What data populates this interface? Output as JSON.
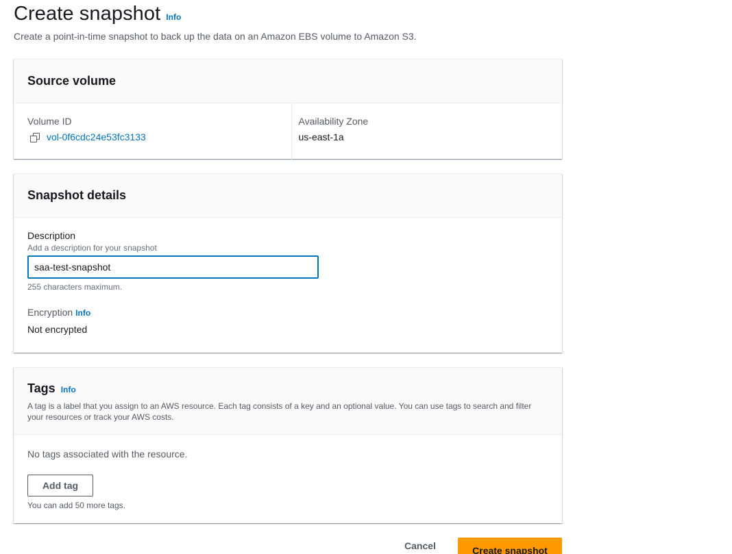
{
  "header": {
    "title": "Create snapshot",
    "info": "Info",
    "description": "Create a point-in-time snapshot to back up the data on an Amazon EBS volume to Amazon S3."
  },
  "source_volume": {
    "title": "Source volume",
    "volume_id_label": "Volume ID",
    "volume_id": "vol-0f6cdc24e53fc3133",
    "az_label": "Availability Zone",
    "az": "us-east-1a"
  },
  "snapshot_details": {
    "title": "Snapshot details",
    "description_label": "Description",
    "description_hint": "Add a description for your snapshot",
    "description_value": "saa-test-snapshot",
    "description_constraint": "255 characters maximum.",
    "encryption_label": "Encryption",
    "encryption_info": "Info",
    "encryption_value": "Not encrypted"
  },
  "tags": {
    "title": "Tags",
    "info": "Info",
    "description": "A tag is a label that you assign to an AWS resource. Each tag consists of a key and an optional value. You can use tags to search and filter your resources or track your AWS costs.",
    "empty": "No tags associated with the resource.",
    "add_label": "Add tag",
    "limit": "You can add 50 more tags."
  },
  "actions": {
    "cancel": "Cancel",
    "submit": "Create snapshot"
  },
  "colors": {
    "link": "#0073bb",
    "primary": "#ff9900",
    "text": "#16191f",
    "muted": "#545b64"
  }
}
